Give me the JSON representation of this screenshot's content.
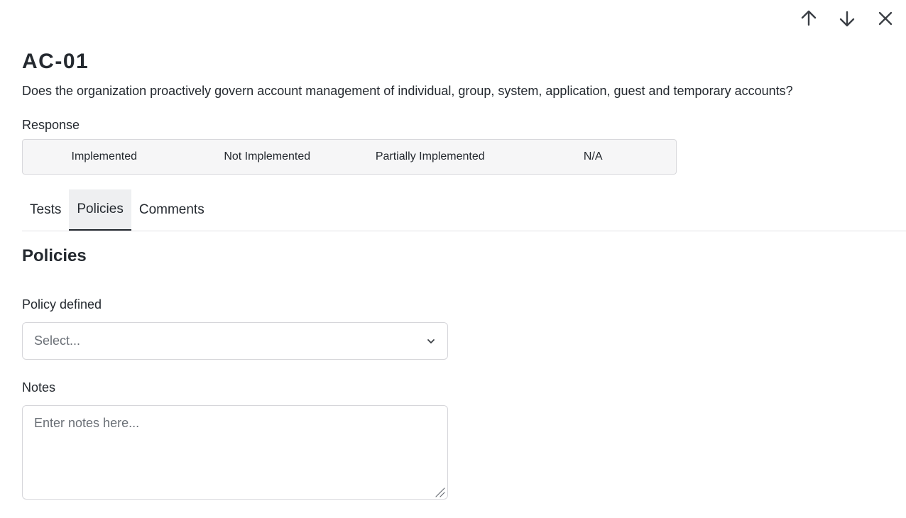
{
  "nav": {
    "prev_icon": "arrow-up-icon",
    "next_icon": "arrow-down-icon",
    "close_icon": "close-icon"
  },
  "control": {
    "id": "AC-01",
    "question": "Does the organization proactively govern account management of individual, group, system, application, guest and temporary accounts?"
  },
  "response": {
    "label": "Response",
    "options": [
      "Implemented",
      "Not Implemented",
      "Partially Implemented",
      "N/A"
    ]
  },
  "tabs": [
    {
      "label": "Tests"
    },
    {
      "label": "Policies",
      "active": true
    },
    {
      "label": "Comments"
    }
  ],
  "policies": {
    "title": "Policies",
    "policy_defined_label": "Policy defined",
    "policy_defined_placeholder": "Select...",
    "notes_label": "Notes",
    "notes_placeholder": "Enter notes here..."
  },
  "colors": {
    "text": "#24292f",
    "muted": "#6a6f76",
    "border": "#d6d6da",
    "active_tab_bg": "#eeeff1"
  }
}
